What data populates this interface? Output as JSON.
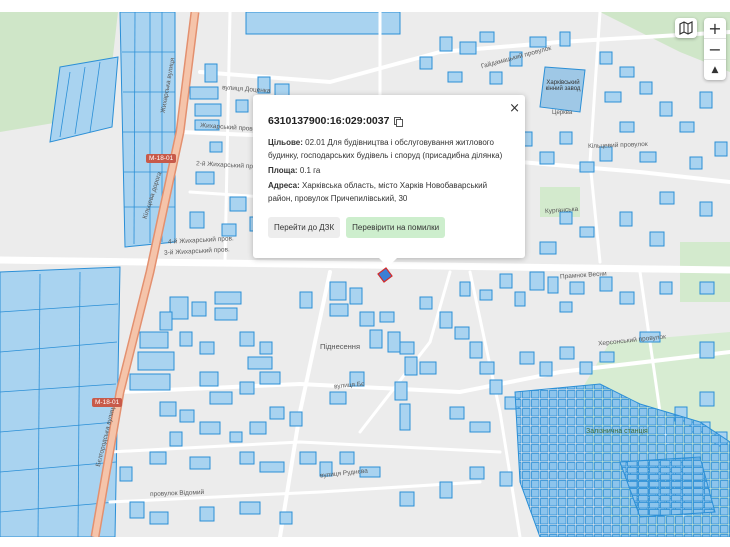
{
  "map": {
    "labels": {
      "street_1": "вулиця Доценка",
      "street_2": "4-й Жихарський пров.",
      "street_3": "3-й Жихарський пров.",
      "street_4": "2-й Жихарський пров.",
      "street_5": "Жихарський пров.",
      "street_6": "Кільцева дорога",
      "street_7": "Жихарська вулиця",
      "street_8": "Бєлгородська вулиця",
      "street_9": "вулиця Бє",
      "street_10": "Прамнок Весни",
      "street_11": "Херсонський провулок",
      "street_12": "вулиця Руднєва",
      "street_13": "провулок Відомий",
      "street_14": "Курганська",
      "street_15": "Гайдамацький провулок",
      "street_16": "Кільцевий провулок",
      "district_1": "Піднесення",
      "district_2": "Залізнична станція",
      "poi_1": "Харківський кінний завод",
      "poi_2": "Церква",
      "road_ref_1": "М-18-01",
      "road_ref_2": "М-18-01"
    }
  },
  "controls": {
    "zoom_in": "+",
    "zoom_out": "−",
    "compass": "▲"
  },
  "popup": {
    "cadastral_number": "6310137900:16:029:0037",
    "purpose_label": "Цільове:",
    "purpose_value": "02.01 Для будівництва і обслуговування житлового будинку, господарських будівель і споруд (присадибна ділянка)",
    "area_label": "Площа:",
    "area_value": "0.1 га",
    "address_label": "Адреса:",
    "address_value": "Харківська область, місто Харків Новобаварський район, провулок Причепилівський, 30",
    "button_dzk": "Перейти до ДЗК",
    "button_check": "Перевірити на помилки",
    "close": "×"
  },
  "colors": {
    "parcel_fill": "#a9d3f0",
    "parcel_stroke": "#2b8fd6",
    "selected_parcel": "#3a7fd5",
    "highway": "#e8a080",
    "green_area": "#cfe8c9",
    "water": "#9fc8e6"
  }
}
